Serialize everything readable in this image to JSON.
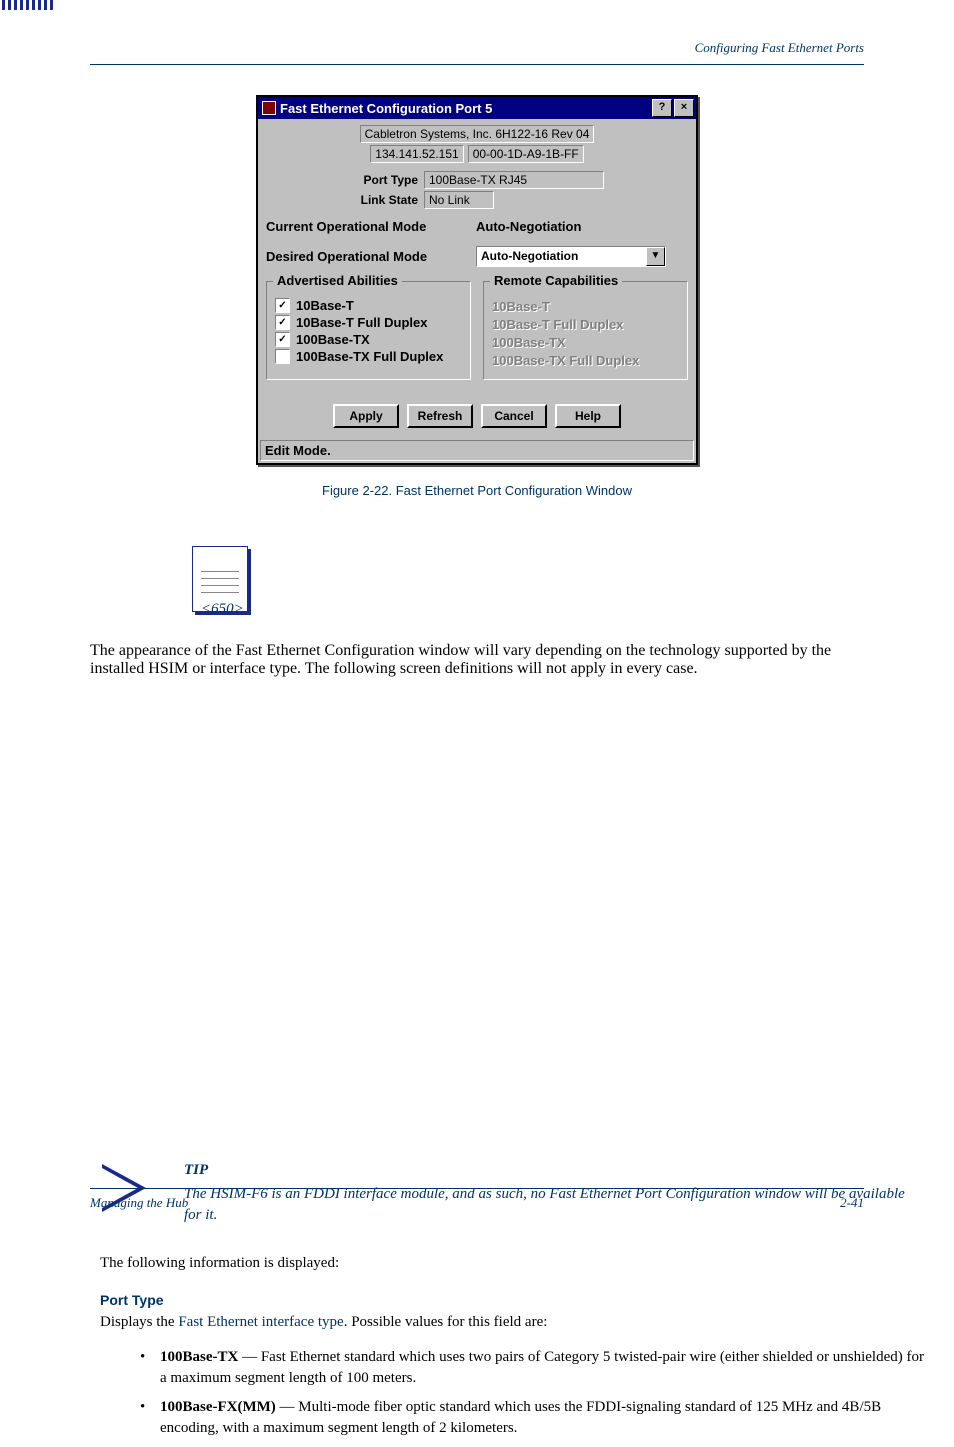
{
  "header": {
    "right": "Configuring Fast Ethernet Ports"
  },
  "dialog": {
    "title": "Fast Ethernet Configuration Port  5",
    "help_btn": "?",
    "close_btn": "×",
    "vendor": "Cabletron Systems, Inc. 6H122-16 Rev 04",
    "ip": "134.141.52.151",
    "mac": "00-00-1D-A9-1B-FF",
    "port_type_label": "Port Type",
    "port_type_value": "100Base-TX RJ45",
    "link_state_label": "Link State",
    "link_state_value": "No Link",
    "current_mode_label": "Current Operational Mode",
    "current_mode_value": "Auto-Negotiation",
    "desired_mode_label": "Desired Operational Mode",
    "desired_mode_value": "Auto-Negotiation",
    "advertised_title": "Advertised Abilities",
    "advertised": [
      {
        "label": "10Base-T",
        "checked": true
      },
      {
        "label": "10Base-T Full Duplex",
        "checked": true
      },
      {
        "label": "100Base-TX",
        "checked": true
      },
      {
        "label": "100Base-TX Full Duplex",
        "checked": false
      }
    ],
    "remote_title": "Remote Capabilities",
    "remote": [
      "10Base-T",
      "10Base-T Full Duplex",
      "100Base-TX",
      "100Base-TX Full Duplex"
    ],
    "buttons": {
      "apply": "Apply",
      "refresh": "Refresh",
      "cancel": "Cancel",
      "help": "Help"
    },
    "status": "Edit Mode."
  },
  "caption": "Figure 2-22. Fast Ethernet Port Configuration Window",
  "note": "The appearance of the Fast Ethernet Configuration window will vary depending on the technology supported by the installed HSIM or interface type. The following screen definitions will not apply in every case.",
  "tip_heading": "TIP",
  "tip_msg": "The HSIM-F6 is an FDDI interface module, and as such, no Fast Ethernet Port Configuration window will be available for it.",
  "intro": "The following information is displayed:",
  "fields": {
    "port_type": {
      "heading": "Port Type",
      "desc_pre": "Displays the ",
      "desc_link": "Fast Ethernet interface type",
      "desc_post": ". Possible values for this field are:"
    }
  },
  "bullets": [
    {
      "bold": "100Base-TX",
      "rest": " — Fast Ethernet standard which uses two pairs of Category 5 twisted-pair wire (either shielded or unshielded) for a maximum segment length of 100 meters."
    },
    {
      "bold": "100Base-FX(MM)",
      "rest": " — Multi-mode fiber optic standard which uses the FDDI-signaling standard of 125 MHz and 4B/5B encoding, with a maximum segment length of 2 kilometers."
    }
  ],
  "footer": {
    "left": "Managing the Hub",
    "right": "2-41"
  }
}
